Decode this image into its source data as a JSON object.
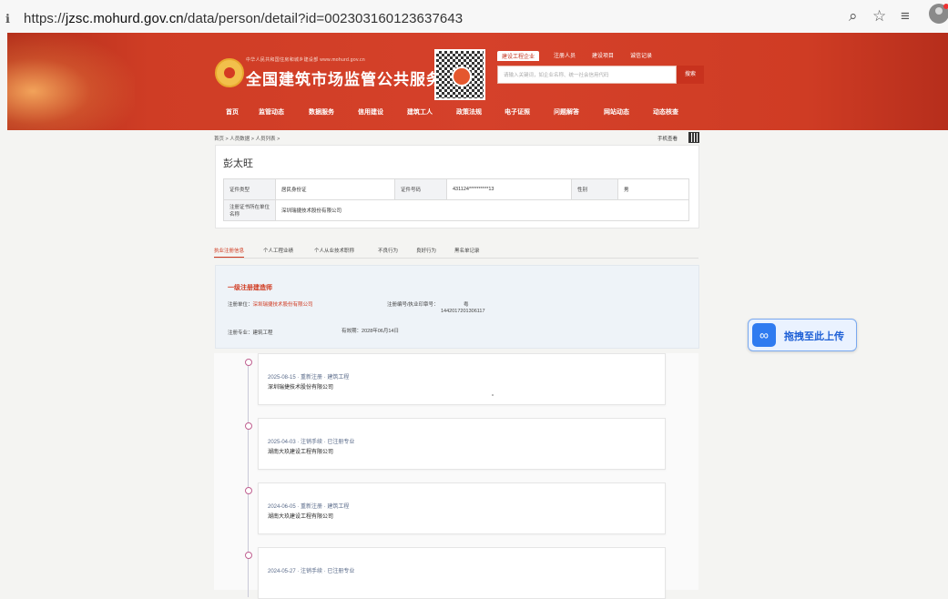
{
  "browser": {
    "url_prefix": "https://",
    "url_host": "jzsc.mohurd.gov.cn",
    "url_path": "/data/person/detail?id=002303160123637643",
    "icons": [
      "info-icon",
      "zoom-icon",
      "star-icon",
      "favorites-icon",
      "profile-icon"
    ]
  },
  "header": {
    "subtitle": "中华人民共和国住房和城乡建设部 www.mohurd.gov.cn",
    "title": "全国建筑市场监管公共服务平台",
    "search_tabs": [
      "建设工程企业",
      "注册人员",
      "建设项目",
      "诚信记录"
    ],
    "search_placeholder": "请输入关键词，如企业名称、统一社会信用代码",
    "search_button": "搜索"
  },
  "nav": [
    "首页",
    "监管动态",
    "数据服务",
    "信用建设",
    "建筑工人",
    "政策法规",
    "电子证照",
    "问题解答",
    "网站动态",
    "动态核查"
  ],
  "breadcrumb": "首页 > 人员数据 > 人员列表 >",
  "mobile_link": "手机查看",
  "person": {
    "name": "彭太旺",
    "labels": {
      "id_type": "证件类型",
      "id_number": "证件号码",
      "gender": "性别",
      "reg_unit": "注册证书所在单位名称"
    },
    "id_type": "居民身份证",
    "id_number": "431124**********13",
    "gender": "男",
    "reg_unit": "深圳瑞捷技术股份有限公司"
  },
  "tabs": [
    "执业注册信息",
    "个人工程业绩",
    "个人从业技术职称",
    "不良行为",
    "良好行为",
    "黑名单记录"
  ],
  "registration": {
    "title": "一级注册建造师",
    "unit_label": "注册单位：",
    "unit": "深圳瑞捷技术股份有限公司",
    "cert_label": "注册编号/执业印章号：",
    "cert_value_1": "粤",
    "cert_value_2": "1442017201306117",
    "major_label": "注册专业：",
    "major": "建筑工程",
    "valid_label": "有效期：",
    "valid": "2028年06月14日"
  },
  "timeline": [
    {
      "date": "2025-08-15 · 重新注册 · 建筑工程",
      "company": "深圳瑞捷技术股份有限公司"
    },
    {
      "date": "2025-04-03 · 注销手续 · 已注册专业",
      "company": "湖南大玖建设工程有限公司"
    },
    {
      "date": "2024-06-05 · 重新注册 · 建筑工程",
      "company": "湖南大玖建设工程有限公司"
    },
    {
      "date": "2024-05-27 · 注销手续 · 已注册专业",
      "company": ""
    }
  ],
  "upload_widget": {
    "label": "拖拽至此上传",
    "icon": "cloud-link-icon"
  }
}
